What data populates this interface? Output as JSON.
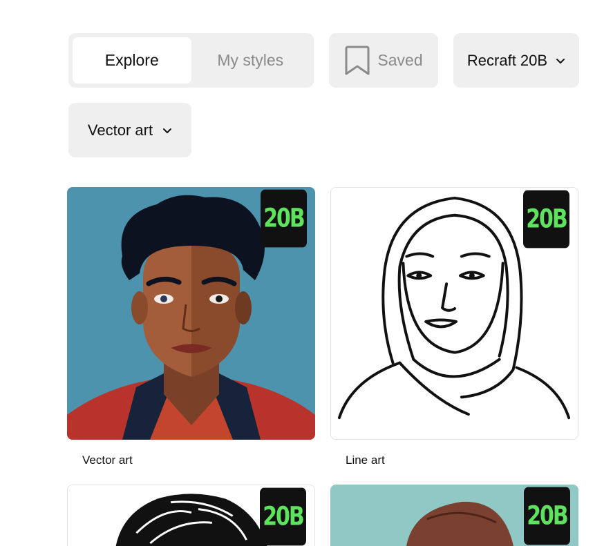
{
  "tabs": {
    "explore": "Explore",
    "my_styles": "My styles"
  },
  "saved": {
    "label": "Saved",
    "icon": "bookmark-icon"
  },
  "model_select": {
    "value": "Recraft 20B",
    "icon": "chevron-down-icon"
  },
  "style_select": {
    "value": "Vector art",
    "icon": "chevron-down-icon"
  },
  "cards": [
    {
      "badge": "20B",
      "caption": "Vector art"
    },
    {
      "badge": "20B",
      "caption": "Line art"
    },
    {
      "badge": "20B",
      "caption": ""
    },
    {
      "badge": "20B",
      "caption": ""
    }
  ],
  "colors": {
    "panel_bg": "#efefef",
    "badge_bg": "#111111",
    "badge_text": "#5fe35f",
    "card1_bg": "#4e93ad",
    "card4_bg": "#8fc8c4"
  }
}
